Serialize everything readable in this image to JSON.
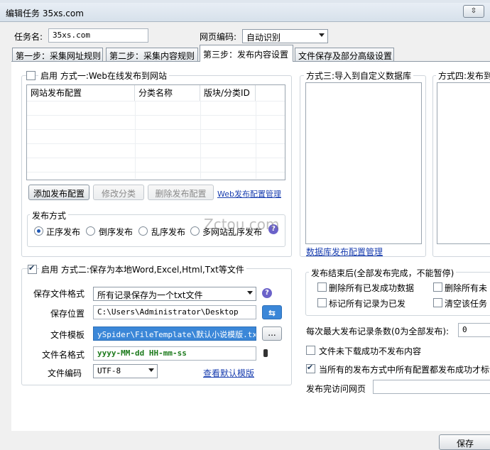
{
  "window": {
    "title": "编辑任务 35xs.com",
    "restore_label": "⇳"
  },
  "task": {
    "name_label": "任务名:",
    "name_value": "35xs.com",
    "encoding_label": "网页编码:",
    "encoding_value": "自动识别"
  },
  "tabs": [
    {
      "label": "第一步：采集网址规则"
    },
    {
      "label": "第二步：采集内容规则"
    },
    {
      "label": "第三步：发布内容设置"
    },
    {
      "label": "文件保存及部分高级设置"
    }
  ],
  "method1": {
    "enable_label": "启用",
    "title": "方式一:Web在线发布到网站",
    "columns": [
      "网站发布配置",
      "分类名称",
      "版块/分类ID"
    ],
    "add_btn": "添加发布配置",
    "edit_btn": "修改分类",
    "delete_btn": "删除发布配置",
    "manage_link": "Web发布配置管理",
    "publish_mode_title": "发布方式",
    "modes": [
      "正序发布",
      "倒序发布",
      "乱序发布",
      "多网站乱序发布"
    ]
  },
  "method2": {
    "enable_label": "启用",
    "title": "方式二:保存为本地Word,Excel,Html,Txt等文件",
    "format_label": "保存文件格式",
    "format_value": "所有记录保存为一个txt文件",
    "location_label": "保存位置",
    "location_value": "C:\\Users\\Administrator\\Desktop",
    "template_label": "文件模板",
    "template_value": "ySpider\\FileTemplate\\默认小说模版.txt",
    "browse_label": "...",
    "filename_label": "文件名格式",
    "filename_value": "yyyy-MM-dd HH-mm-ss",
    "encoding_label": "文件编码",
    "encoding_value": "UTF-8",
    "view_default_link": "查看默认模版"
  },
  "method3": {
    "title": "方式三:导入到自定义数据库",
    "manage_link": "数据库发布配置管理"
  },
  "method4": {
    "title": "方式四:发布到"
  },
  "after_publish": {
    "title": "发布结束后(全部发布完成，不能暂停)",
    "options": [
      "删除所有已发成功数据",
      "删除所有未",
      "标记所有记录为已发",
      "清空该任务"
    ]
  },
  "settings": {
    "max_records_label": "每次最大发布记录条数(0为全部发布):",
    "max_records_value": "0",
    "no_publish_label": "文件未下载成功不发布内容",
    "all_success_label": "当所有的发布方式中所有配置都发布成功才标记",
    "visit_url_label": "发布完访问网页",
    "visit_url_value": ""
  },
  "footer": {
    "save_btn": "保存"
  },
  "watermark": "Zctou.com",
  "colors": {
    "accent": "#1a3fb0",
    "highlight": "#3b87d8"
  }
}
